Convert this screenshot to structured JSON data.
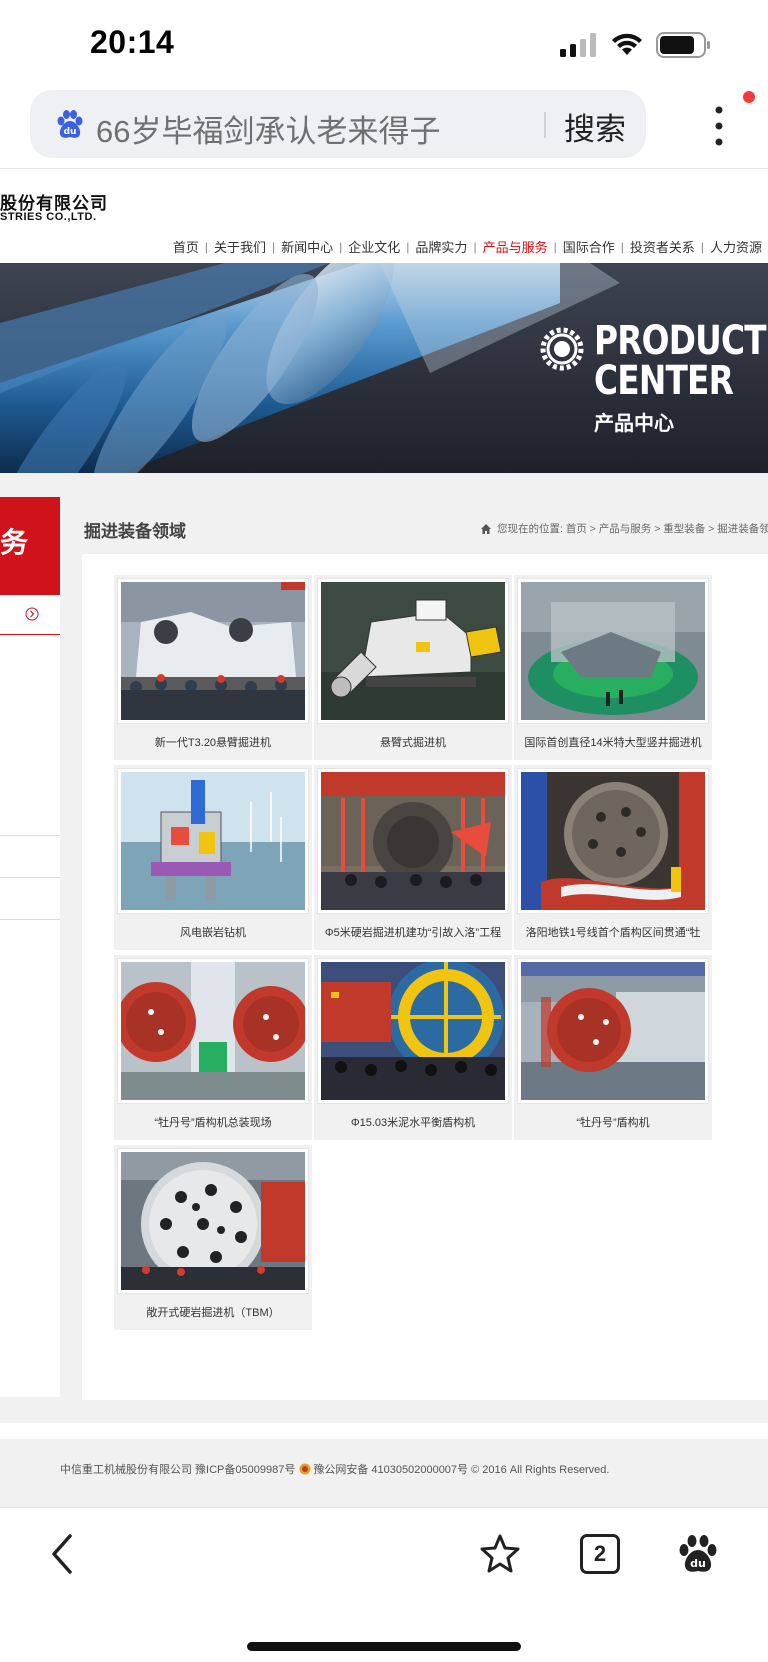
{
  "status_bar": {
    "time": "20:14"
  },
  "browser": {
    "search_query": "66岁毕福剑承认老来得子",
    "search_button": "搜索",
    "tab_count": "2"
  },
  "site": {
    "logo_cn": "股份有限公司",
    "logo_en": "STRIES CO.,LTD.",
    "nav": [
      {
        "label": "首页",
        "active": false
      },
      {
        "label": "关于我们",
        "active": false
      },
      {
        "label": "新闻中心",
        "active": false
      },
      {
        "label": "企业文化",
        "active": false
      },
      {
        "label": "品牌实力",
        "active": false
      },
      {
        "label": "产品与服务",
        "active": true
      },
      {
        "label": "国际合作",
        "active": false
      },
      {
        "label": "投资者关系",
        "active": false
      },
      {
        "label": "人力资源",
        "active": false
      }
    ],
    "banner": {
      "line1": "PRODUCT",
      "line2": "CENTER",
      "cn": "产品中心"
    },
    "sidebar_title": "务",
    "page_heading": "掘进装备领域",
    "breadcrumb": {
      "prefix": "您现在的位置:",
      "items": [
        "首页",
        "产品与服务",
        "重型装备",
        "掘进装备领域"
      ],
      "separator": " > "
    },
    "products": [
      {
        "caption": "新一代T3.20悬臂掘进机",
        "thumb": "roadheader-factory-photo"
      },
      {
        "caption": "悬臂式掘进机",
        "thumb": "roadheader-render"
      },
      {
        "caption": "国际首创直径14米特大型竖井掘进机",
        "thumb": "shaft-boring-machine-photo"
      },
      {
        "caption": "风电嵌岩钻机",
        "thumb": "wind-rock-drill-render"
      },
      {
        "caption": "Φ5米硬岩掘进机建功“引故入洛”工程",
        "thumb": "hard-rock-tbm-ceremony"
      },
      {
        "caption": "洛阳地铁1号线首个盾构区间贯通“牡",
        "thumb": "metro-breakthrough-photo"
      },
      {
        "caption": "“牡丹号”盾构机总装现场",
        "thumb": "assembly-site-photo"
      },
      {
        "caption": "Φ15.03米泥水平衡盾构机",
        "thumb": "slurry-shield-photo"
      },
      {
        "caption": "“牡丹号”盾构机",
        "thumb": "peony-shield-photo"
      },
      {
        "caption": "敞开式硬岩掘进机（TBM）",
        "thumb": "open-tbm-photo"
      }
    ],
    "footer": {
      "left": "中信重工机械股份有限公司 豫ICP备05009987号",
      "right": "豫公网安备 41030502000007号 © 2016 All Rights Reserved."
    }
  },
  "colors": {
    "brand_red": "#d0131b",
    "panel_gray": "#f1f1f1"
  },
  "icons": [
    "signal-icon",
    "wifi-icon",
    "battery-icon",
    "baidu-icon",
    "menu-icon",
    "gear-icon",
    "home-icon",
    "police-badge-icon",
    "back-icon",
    "star-icon",
    "paw-icon"
  ]
}
